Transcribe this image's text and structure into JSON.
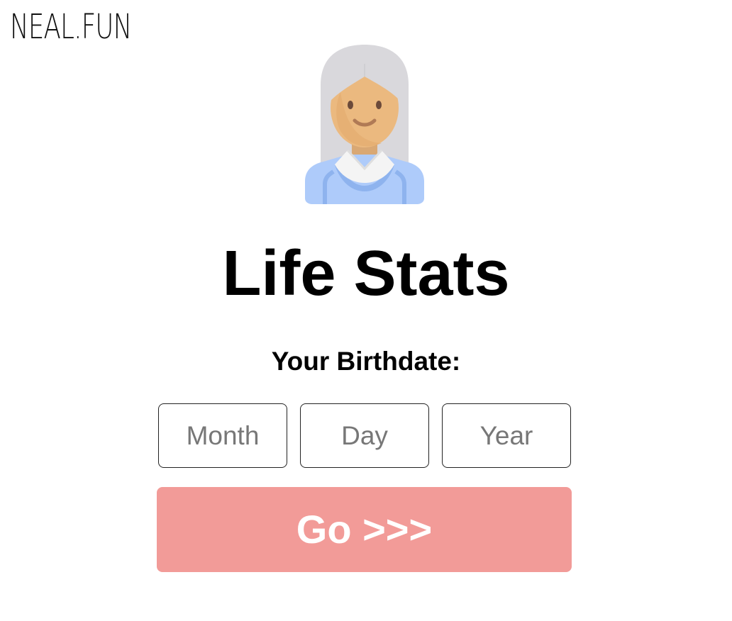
{
  "header": {
    "logo_text": "NEAL.FUN"
  },
  "hero": {
    "avatar_icon": "grandmother-avatar-icon"
  },
  "main": {
    "title": "Life Stats",
    "birthdate_label": "Your Birthdate:",
    "inputs": {
      "month_placeholder": "Month",
      "day_placeholder": "Day",
      "year_placeholder": "Year"
    },
    "go_label": "Go >>>"
  },
  "colors": {
    "go_button": "#f29b98",
    "go_text": "#ffffff",
    "hair": "#d9d8dc",
    "skin": "#ebb97f",
    "shirt": "#aecbfa"
  }
}
